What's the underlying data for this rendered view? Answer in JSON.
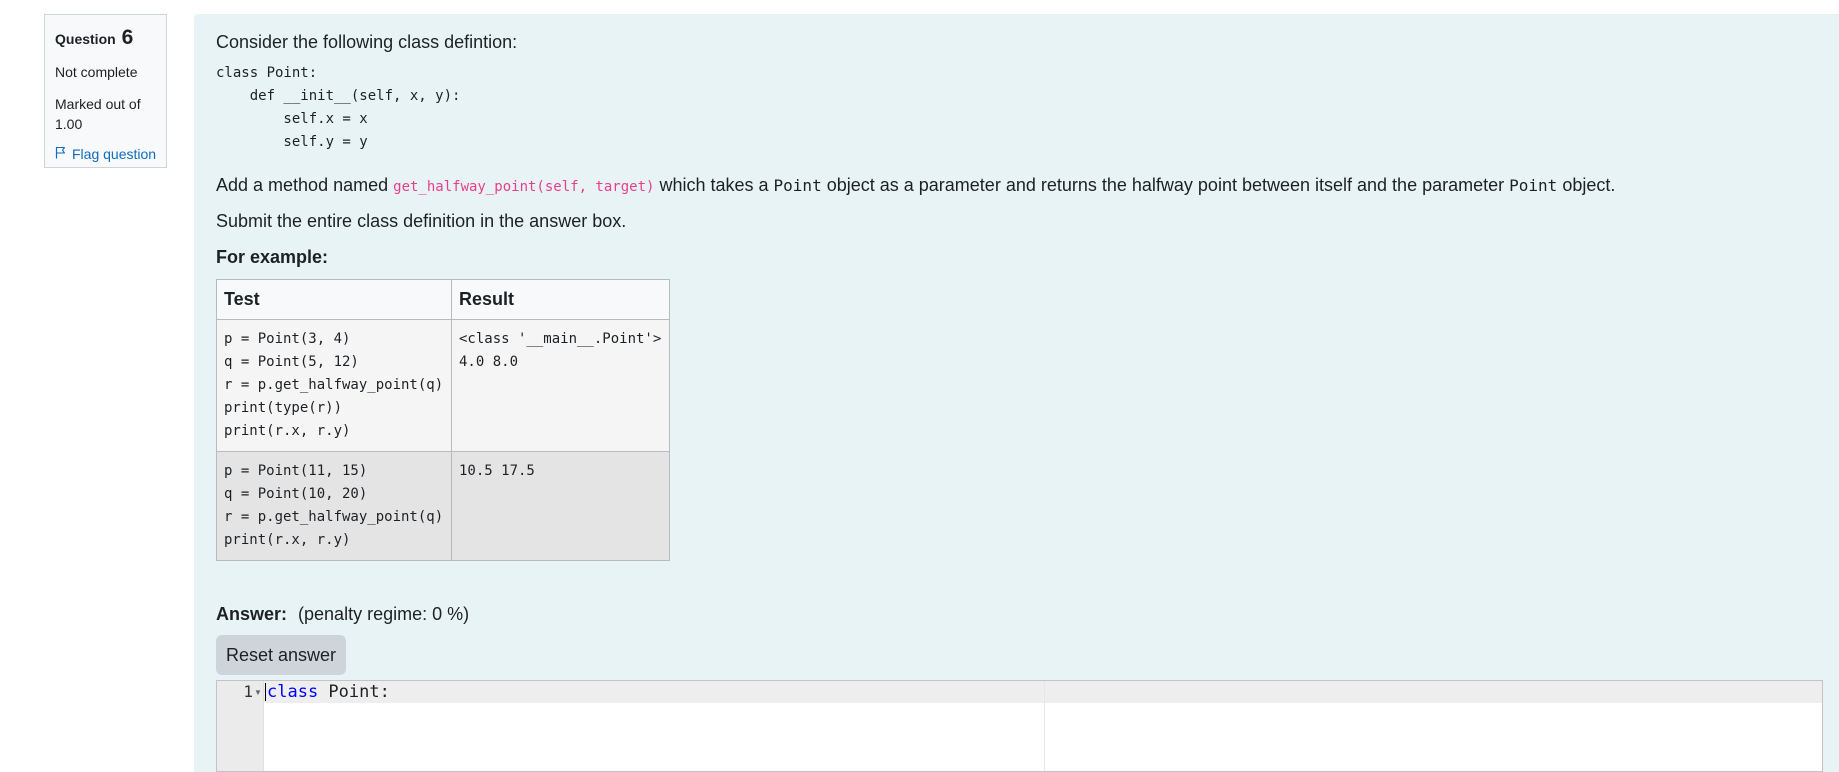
{
  "info": {
    "question_label": "Question",
    "question_number": "6",
    "state": "Not complete",
    "grade": "Marked out of 1.00",
    "flag_label": "Flag question"
  },
  "question": {
    "intro": "Consider the following class defintion:",
    "class_code": "class Point:\n    def __init__(self, x, y):\n        self.x = x\n        self.y = y",
    "para1_prefix": "Add a method named",
    "method_signature": "get_halfway_point(self, target)",
    "para1_middle": "which takes a",
    "type_name": "Point",
    "para1_after_type": "object as a parameter and returns the halfway point between itself and the parameter",
    "type_name_2": "Point",
    "para1_end": "object.",
    "para2": "Submit the entire class definition in the answer box.",
    "for_example": "For example:"
  },
  "examples": {
    "headers": [
      "Test",
      "Result"
    ],
    "rows": [
      {
        "test": "p = Point(3, 4)\nq = Point(5, 12)\nr = p.get_halfway_point(q)\nprint(type(r))\nprint(r.x, r.y)",
        "result": "<class '__main__.Point'>\n4.0 8.0"
      },
      {
        "test": "p = Point(11, 15)\nq = Point(10, 20)\nr = p.get_halfway_point(q)\nprint(r.x, r.y)",
        "result": "10.5 17.5"
      }
    ]
  },
  "answer": {
    "label": "Answer:",
    "penalty": "(penalty regime: 0 %)",
    "reset_label": "Reset answer"
  },
  "editor": {
    "line_number": "1",
    "keyword": "class",
    "rest": " Point:"
  },
  "colors": {
    "panel_bg": "#e7f3f5",
    "link": "#0f6cbf",
    "inline_code": "#e83e8c",
    "keyword": "#0000ff"
  },
  "icons": {
    "flag": "flag-icon",
    "fold": "fold-arrow-icon"
  }
}
